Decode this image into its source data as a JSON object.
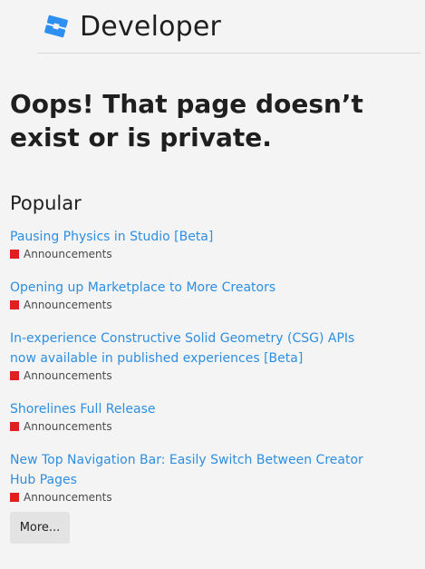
{
  "header": {
    "brand": "Developer",
    "logo_icon": "roblox-studio-logo-icon",
    "accent": "#2d8ff0"
  },
  "main": {
    "title": "Oops! That page doesn’t exist or is private.",
    "popular_heading": "Popular",
    "category_color": "#e02020",
    "items": [
      {
        "title": "Pausing Physics in Studio [Beta]",
        "category": "Announcements"
      },
      {
        "title": "Opening up Marketplace to More Creators",
        "category": "Announcements"
      },
      {
        "title": "In-experience Constructive Solid Geometry (CSG) APIs now available in published experiences [Beta]",
        "category": "Announcements"
      },
      {
        "title": "Shorelines Full Release",
        "category": "Announcements"
      },
      {
        "title": "New Top Navigation Bar: Easily Switch Between Creator Hub Pages",
        "category": "Announcements"
      }
    ],
    "more_label": "More..."
  }
}
